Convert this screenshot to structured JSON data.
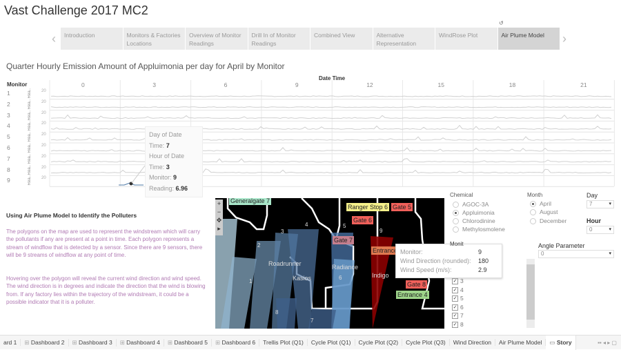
{
  "app": {
    "title": "Vast Challenge 2017 MC2"
  },
  "story_nav": {
    "prev_icon": "chevron-left-icon",
    "next_icon": "chevron-right-icon",
    "revert_icon": "undo-icon",
    "points": [
      {
        "label": "Introduction"
      },
      {
        "label": "Monitors & Factories Locations"
      },
      {
        "label": "Overview of Monitor Readings"
      },
      {
        "label": "Drill In of Monitor Readings"
      },
      {
        "label": "Combined View"
      },
      {
        "label": "Alternative Representation"
      },
      {
        "label": "WindRose Plot"
      },
      {
        "label": "Air Plume Model",
        "active": true
      }
    ]
  },
  "chart": {
    "title": "Quarter Hourly Emission Amount of Appluimonia per day for April by Monitor",
    "column_header": "Date Time",
    "row_header": "Monitor",
    "hours": [
      "0",
      "3",
      "6",
      "9",
      "12",
      "15",
      "18",
      "21"
    ],
    "monitors": [
      "1",
      "2",
      "3",
      "4",
      "5",
      "6",
      "7",
      "8",
      "9"
    ],
    "axis_label": "Rea..",
    "axis_tick": "20",
    "line_color": "#4e79a7",
    "tooltip": {
      "day_label": "Day of Date",
      "time_label": "Time:",
      "day_value": "7",
      "hour_label": "Hour of Date",
      "hour_value": "3",
      "monitor_label": "Monitor:",
      "monitor_value": "9",
      "reading_label": "Reading:",
      "reading_value": "6.96"
    }
  },
  "description": {
    "heading": "Using Air Plume Model to Identify the Polluters",
    "p1": "The polygons on the map are used to represent the windstream which will carry the pollutants if any are present at a point in time. Each polygon represents a stream of windflow that is detected by a sensor. Since there are 9 sensors, there will be 9 streams of windflow at any point of time.",
    "p2": "Hovering over the polygon will reveal the current wind direction and wind speed. The wind direction is in degrees and indicate the direction that the wind is blowing from. If any factory lies within the trajectory of the windstream, it could be a possible indicator that it is a polluter.",
    "color": "#b07ab3"
  },
  "map": {
    "controls": [
      "+",
      "−"
    ],
    "labels": [
      {
        "text": "Generalgate 7",
        "color": "#a8e6c9"
      },
      {
        "text": "Ranger Stop 6",
        "color": "#f5f08a"
      },
      {
        "text": "Gate 5",
        "color": "#f0605a"
      },
      {
        "text": "Gate 6",
        "color": "#f0605a"
      },
      {
        "text": "Gate 7",
        "color": "#c57f8e"
      },
      {
        "text": "Entrance",
        "color": "#e07a50"
      },
      {
        "text": "Gate 8",
        "color": "#f0605a"
      },
      {
        "text": "Entrance 4",
        "color": "#9ed48a"
      }
    ],
    "factories": [
      "Roadrunner",
      "Kasios",
      "Radiance",
      "Indigo"
    ],
    "monitors": [
      "1",
      "2",
      "3",
      "4",
      "5",
      "6",
      "7",
      "8",
      "9"
    ],
    "tooltip": {
      "monitor_label": "Monitor:",
      "monitor_value": "9",
      "direction_label": "Wind Direction (rounded):",
      "direction_value": "180",
      "speed_label": "Wind Speed (m/s):",
      "speed_value": "2.9"
    }
  },
  "filters": {
    "chemical": {
      "label": "Chemical",
      "options": [
        "AGOC-3A",
        "Appluimonia",
        "Chlorodinine",
        "Methylosmolene"
      ],
      "selected": "Appluimonia"
    },
    "month": {
      "label": "Month",
      "options": [
        "April",
        "August",
        "December"
      ],
      "selected": "April"
    },
    "day": {
      "label": "Day",
      "value": "7"
    },
    "hour": {
      "label": "Hour",
      "value": "0"
    },
    "angle": {
      "label": "Angle Parameter",
      "value": "0"
    },
    "monitor": {
      "label": "Monit",
      "checked": [
        "3",
        "4",
        "5",
        "6",
        "7",
        "8"
      ]
    }
  },
  "bottom_tabs": [
    {
      "label": "ard 1",
      "icon": "dashboard-icon"
    },
    {
      "label": "Dashboard 2",
      "icon": "dashboard-icon"
    },
    {
      "label": "Dashboard 3",
      "icon": "dashboard-icon"
    },
    {
      "label": "Dashboard 4",
      "icon": "dashboard-icon"
    },
    {
      "label": "Dashboard 5",
      "icon": "dashboard-icon"
    },
    {
      "label": "Dashboard 6",
      "icon": "dashboard-icon"
    },
    {
      "label": "Trellis Plot (Q1)"
    },
    {
      "label": "Cycle Plot (Q1)"
    },
    {
      "label": "Cycle Plot (Q2)"
    },
    {
      "label": "Cycle Plot (Q3)"
    },
    {
      "label": "Wind Direction"
    },
    {
      "label": "Air Plume Model"
    },
    {
      "label": "Story",
      "icon": "story-icon",
      "active": true
    }
  ]
}
